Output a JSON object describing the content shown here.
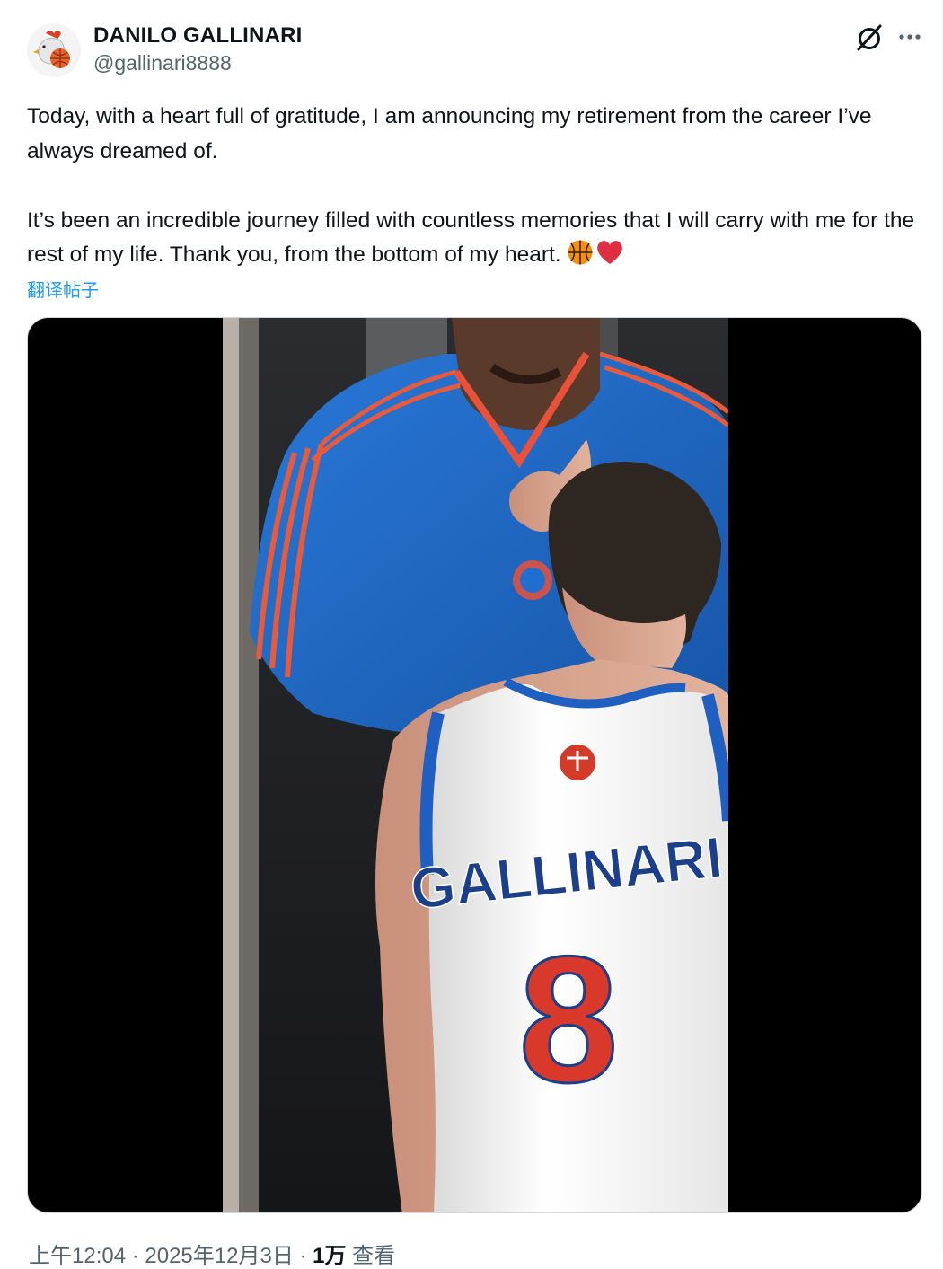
{
  "author": {
    "display_name": "DANILO GALLINARI",
    "handle": "@gallinari8888"
  },
  "post": {
    "paragraph_1": "Today, with a heart full of gratitude, I am announcing my retirement from the career I’ve always dreamed of.",
    "paragraph_2": "It’s been an incredible journey filled with countless memories that I will carry with me for the rest of my life. Thank you, from the bottom of my heart.",
    "emojis": [
      "basketball-emoji",
      "red-heart-emoji"
    ],
    "translate_label": "翻译帖子"
  },
  "media": {
    "type": "video",
    "jersey_name": "GALLINARI",
    "jersey_number": "8"
  },
  "meta": {
    "time": "上午12:04 · 2025年12月3日 · ",
    "views_count": "1万",
    "views_label": " 查看"
  },
  "icons": [
    "grok-icon",
    "more-options-icon"
  ],
  "colors": {
    "link_blue": "#1d9bf0",
    "secondary_text": "#536471",
    "primary_text": "#0f1419",
    "knicks_blue": "#1f6fd1",
    "knicks_orange": "#e8513a"
  }
}
